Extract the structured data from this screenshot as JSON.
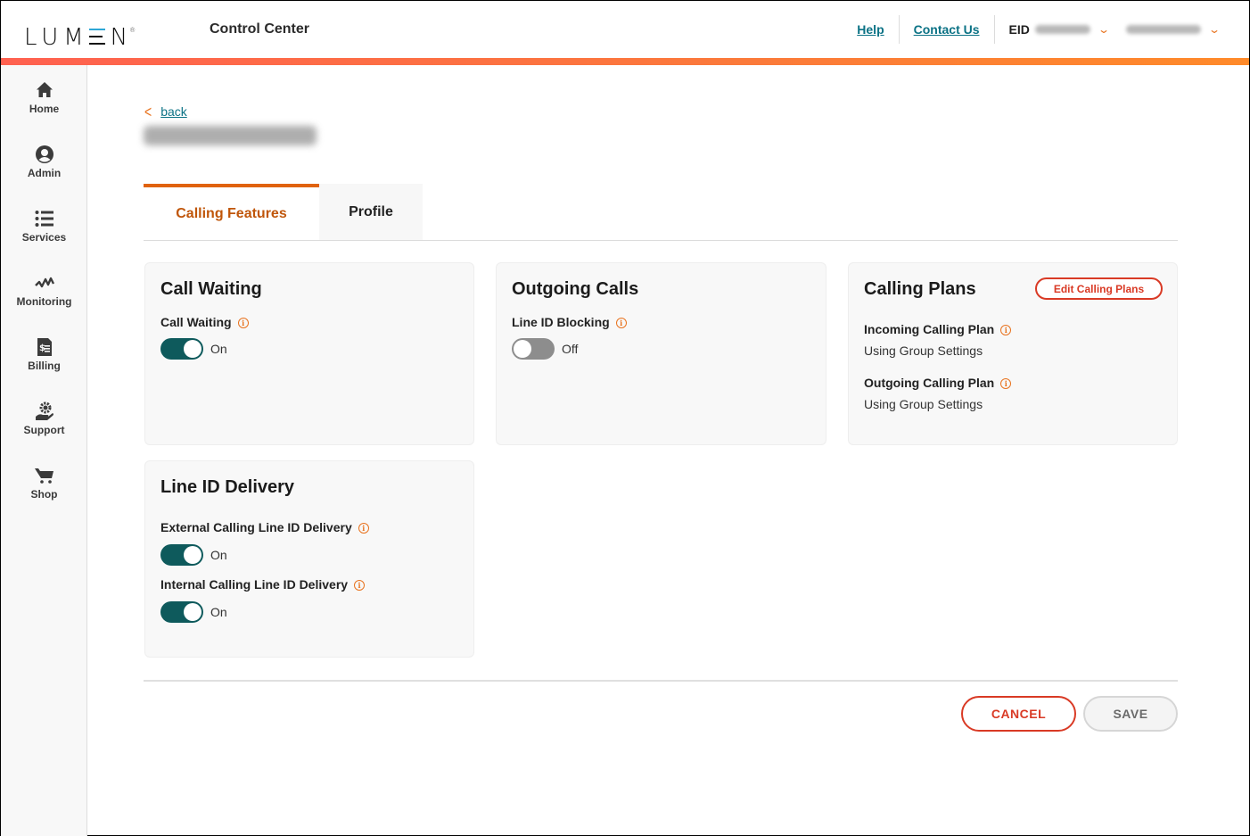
{
  "header": {
    "logo": "LUMEN",
    "app_title": "Control Center",
    "links": [
      {
        "label": "Help"
      },
      {
        "label": "Contact Us"
      }
    ],
    "eid_label": "EID",
    "eid_value": "[redacted]",
    "user_value": "[redacted]",
    "accent_gradient": [
      "#ff6150",
      "#ff8a2a"
    ]
  },
  "sidebar": {
    "items": [
      {
        "label": "Home",
        "icon": "home-icon"
      },
      {
        "label": "Admin",
        "icon": "user-circle-icon"
      },
      {
        "label": "Services",
        "icon": "list-icon"
      },
      {
        "label": "Monitoring",
        "icon": "pulse-icon"
      },
      {
        "label": "Billing",
        "icon": "invoice-icon"
      },
      {
        "label": "Support",
        "icon": "support-gear-hand-icon"
      },
      {
        "label": "Shop",
        "icon": "cart-icon"
      }
    ]
  },
  "page": {
    "back_label": "back",
    "title": "[redacted phone number]",
    "tabs": [
      {
        "label": "Calling Features",
        "active": true
      },
      {
        "label": "Profile",
        "active": false
      }
    ]
  },
  "cards": {
    "call_waiting": {
      "title": "Call Waiting",
      "fields": [
        {
          "label": "Call Waiting",
          "state": "On",
          "enabled": true
        }
      ]
    },
    "outgoing_calls": {
      "title": "Outgoing Calls",
      "fields": [
        {
          "label": "Line ID Blocking",
          "state": "Off",
          "enabled": false
        }
      ]
    },
    "calling_plans": {
      "title": "Calling Plans",
      "edit_button": "Edit Calling Plans",
      "fields": [
        {
          "label": "Incoming Calling Plan",
          "value": "Using Group Settings"
        },
        {
          "label": "Outgoing Calling Plan",
          "value": "Using Group Settings"
        }
      ]
    },
    "line_id_delivery": {
      "title": "Line ID Delivery",
      "fields": [
        {
          "label": "External Calling Line ID Delivery",
          "state": "On",
          "enabled": true
        },
        {
          "label": "Internal Calling Line ID Delivery",
          "state": "On",
          "enabled": true
        }
      ]
    }
  },
  "footer": {
    "cancel_label": "CANCEL",
    "save_label": "SAVE"
  },
  "colors": {
    "accent_orange": "#e0620d",
    "link_teal": "#0b7285",
    "toggle_on": "#0e5a5c",
    "toggle_off": "#8d8d8d",
    "danger_red": "#d93a25"
  }
}
